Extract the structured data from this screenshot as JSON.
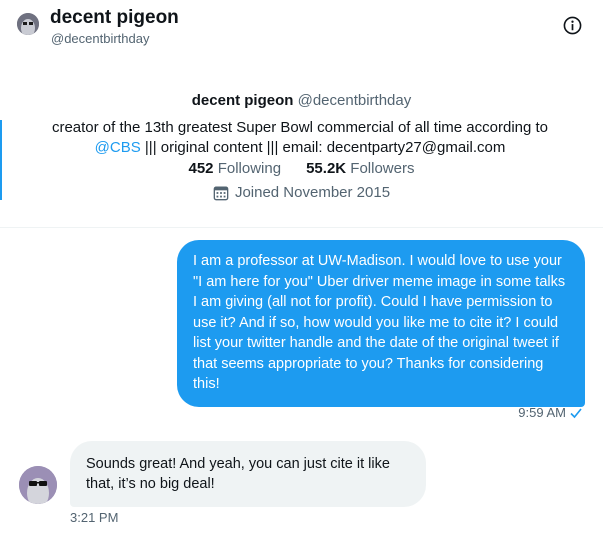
{
  "header": {
    "name": "decent pigeon",
    "handle": "@decentbirthday",
    "info_icon": "info-circle-icon"
  },
  "profile": {
    "name": "decent pigeon",
    "handle": "@decentbirthday",
    "bio_part1": "creator of the 13th greatest Super Bowl commercial of all time according to ",
    "bio_link": "@CBS",
    "bio_part2": " ||| original content ||| email: decentparty27@gmail.com",
    "following_count": "452",
    "following_label": "Following",
    "followers_count": "55.2K",
    "followers_label": "Followers",
    "joined": "Joined November 2015",
    "link_color": "#1d9bf0"
  },
  "messages": [
    {
      "direction": "outgoing",
      "text": "I am a professor at UW-Madison.  I would love to use your \"I am here for you\" Uber driver meme image in some talks I am giving (all not for profit).  Could I have permission to use it?  And if so, how would you like me to cite it?  I could list your twitter handle and the date of the original tweet if that seems appropriate to you?  Thanks for considering this!",
      "time": "9:59 AM",
      "status_icon": "checkmark-icon",
      "bubble_color": "#1d9bf0"
    },
    {
      "direction": "incoming",
      "text": "Sounds great! And yeah, you can just cite it like that, it’s no big deal!",
      "time": "3:21 PM",
      "bubble_color": "#eff3f4"
    }
  ]
}
